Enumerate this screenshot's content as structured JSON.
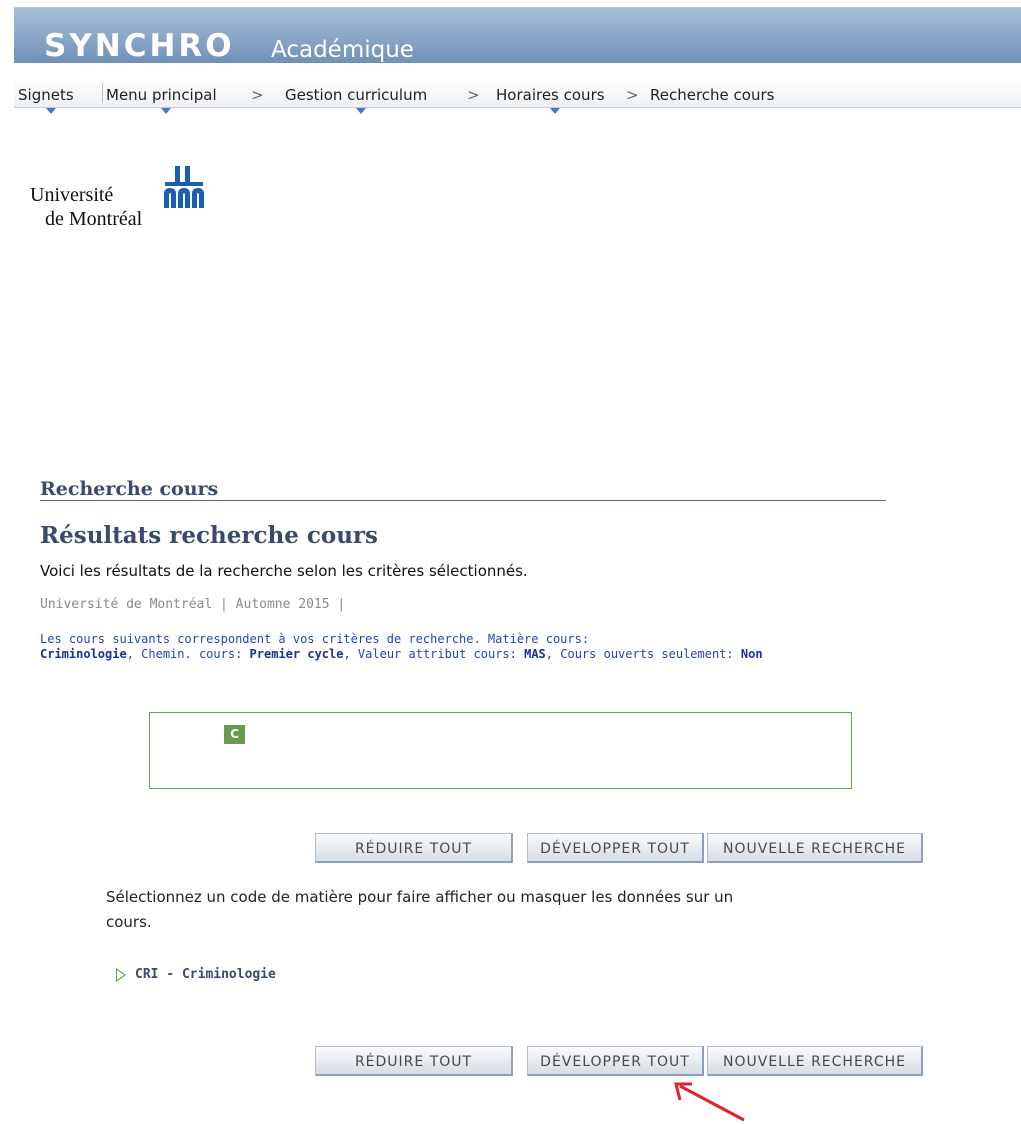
{
  "app": {
    "brand": "SYNCHRO",
    "module": "Académique"
  },
  "breadcrumbs": [
    {
      "label": "Signets"
    },
    {
      "label": "Menu principal"
    },
    {
      "label": "Gestion curriculum"
    },
    {
      "label": "Horaires cours"
    },
    {
      "label": "Recherche cours"
    }
  ],
  "breadcrumb_separator": ">",
  "logo": {
    "line1": "Université",
    "line2": "de Montréal"
  },
  "section_title": "Recherche cours",
  "page_title": "Résultats recherche cours",
  "intro_text": "Voici les résultats de la recherche selon les critères sélectionnés.",
  "term_text": "Université de Montréal | Automne 2015 |",
  "criteria": {
    "lead": "Les cours suivants correspondent à vos critères de recherche. Matière cours:",
    "subject_value": "Criminologie",
    "path_label": "Chemin. cours:",
    "path_value": "Premier cycle",
    "attribute_label": "Valeur attribut cours:",
    "attribute_value": "MAS",
    "open_label": "Cours ouverts seulement:",
    "open_value": "Non"
  },
  "legend_chip": "C",
  "buttons": {
    "collapse_all": "RÉDUIRE TOUT",
    "expand_all": "DÉVELOPPER TOUT",
    "new_search": "NOUVELLE RECHERCHE"
  },
  "help_text": "Sélectionnez un code de matière pour faire afficher ou masquer les données sur un cours.",
  "course_group": "CRI - Criminologie",
  "colors": {
    "banner": "#6f91b7",
    "title": "#3a4a6b",
    "criteria_text": "#2741c4",
    "legend_border": "#5aaa46",
    "annotation_arrow": "#e0202a"
  }
}
